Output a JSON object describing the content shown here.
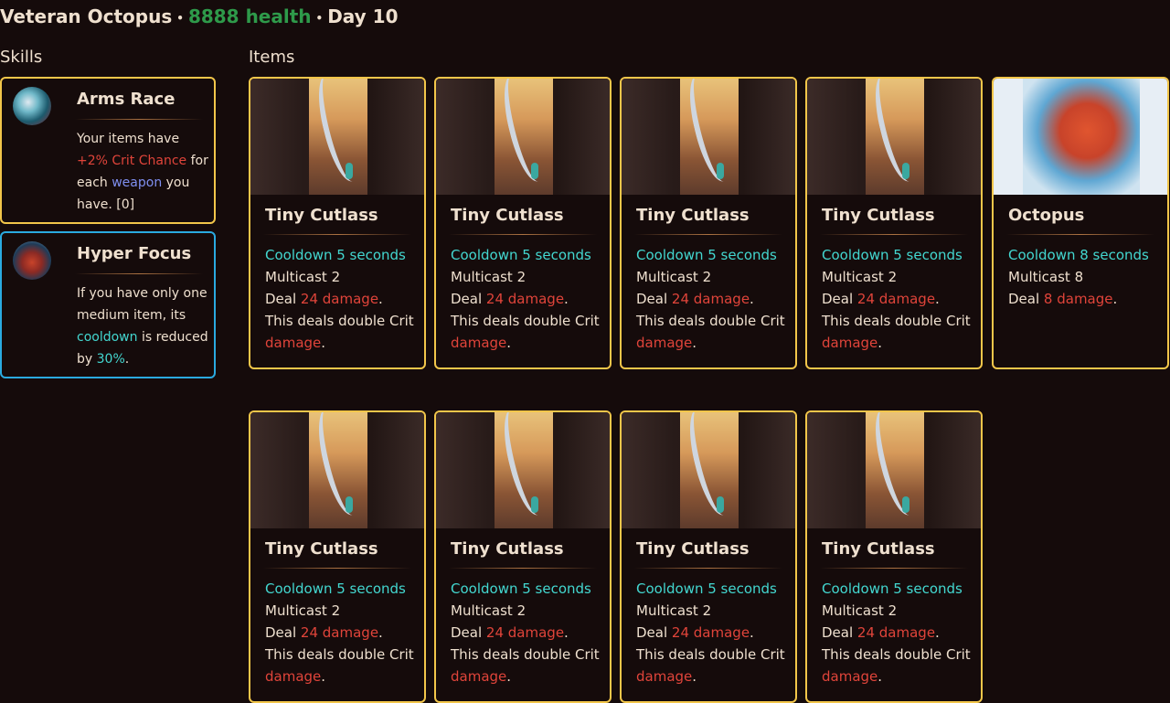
{
  "header": {
    "name": "Veteran Octopus",
    "health": "8888 health",
    "day": "Day 10"
  },
  "colors": {
    "health": "#2e9a4a",
    "item_border": "#f2c64a",
    "skill_border_gold": "#f2c64a",
    "skill_border_blue": "#2aaae0",
    "cooldown": "#43d7d0",
    "damage": "#e0443a",
    "weapon": "#7f8ff0"
  },
  "sections": {
    "skills": "Skills",
    "items": "Items"
  },
  "skills": [
    {
      "name": "Arms Race",
      "icon": "arrow-icon",
      "desc": {
        "a": "Your items have",
        "b": "+2% Crit Chance",
        "c": "for",
        "d": "each",
        "e": "weapon",
        "f": "you",
        "g": "have. [0]"
      }
    },
    {
      "name": "Hyper Focus",
      "icon": "octopus-icon",
      "desc": {
        "a": "If you have only one",
        "b": "medium item, its",
        "c": "cooldown",
        "d": "is reduced",
        "e": "by",
        "f": "30%",
        "g": "."
      }
    }
  ],
  "cutlass": {
    "title": "Tiny Cutlass",
    "cooldown": "Cooldown 5 seconds",
    "multicast": "Multicast 2",
    "deal": "Deal",
    "damage_value": "24 damage",
    "crit_text": "This deals double Crit",
    "crit_damage": "damage"
  },
  "octopus": {
    "title": "Octopus",
    "cooldown": "Cooldown 8 seconds",
    "multicast": "Multicast 8",
    "deal": "Deal",
    "damage_value": "8 damage"
  },
  "punct": {
    "period": ".",
    "dot": "•"
  }
}
